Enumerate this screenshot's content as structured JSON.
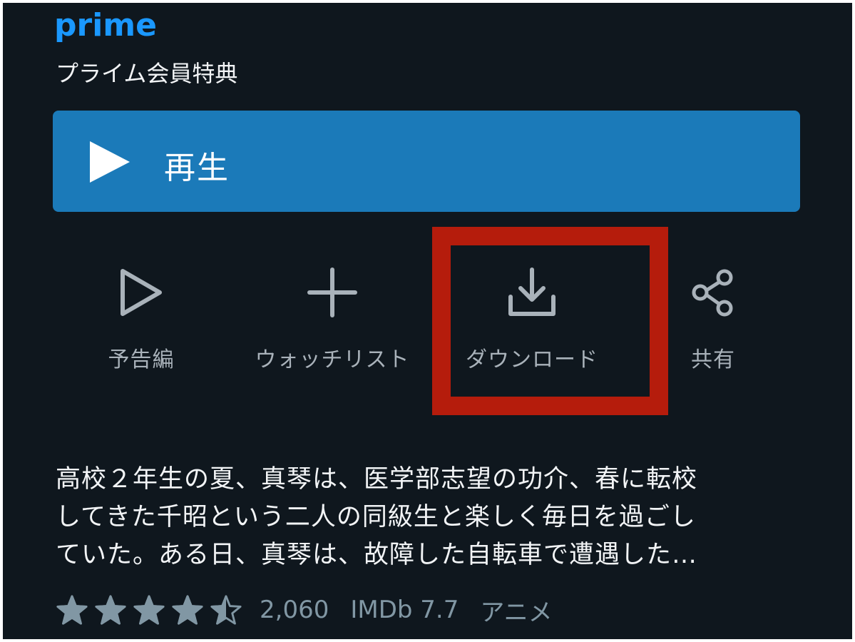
{
  "header": {
    "logo": "prime",
    "benefit_label": "プライム会員特典"
  },
  "play": {
    "label": "再生",
    "icon": "play-icon"
  },
  "actions": [
    {
      "label": "予告編",
      "icon": "trailer-play-icon"
    },
    {
      "label": "ウォッチリスト",
      "icon": "plus-icon"
    },
    {
      "label": "ダウンロード",
      "icon": "download-icon"
    },
    {
      "label": "共有",
      "icon": "share-icon"
    }
  ],
  "description": {
    "lines": [
      "高校２年生の夏、真琴は、医学部志望の功介、春に転校",
      "してきた千昭という二人の同級生と楽しく毎日を過ごし",
      "ていた。ある日、真琴は、故障した自転車で遭遇した…"
    ]
  },
  "meta": {
    "rating_stars": 4.5,
    "rating_max": 5,
    "rating_count": "2,060",
    "imdb": "IMDb 7.7",
    "genre": "アニメ"
  },
  "colors": {
    "background": "#0f171e",
    "prime_blue": "#1a98ff",
    "play_button": "#1b7ab9",
    "highlight": "#b51c0c",
    "muted_text": "#a9b2ba",
    "star": "#8197a4"
  }
}
